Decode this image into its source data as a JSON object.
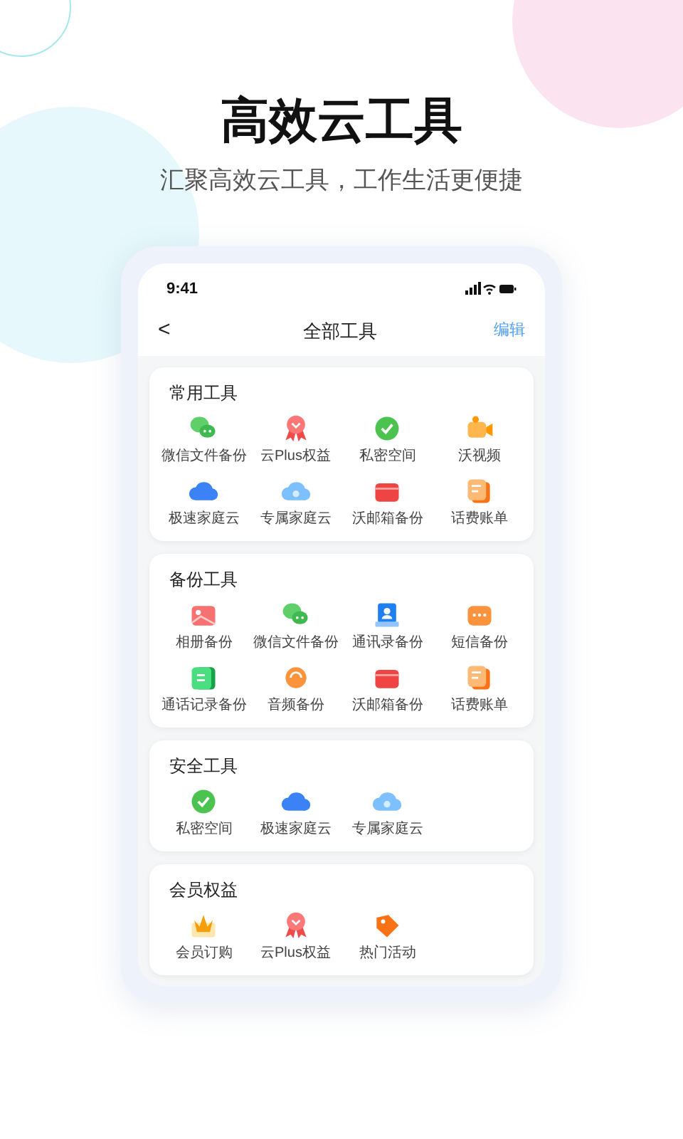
{
  "headline": "高效云工具",
  "subtitle": "汇聚高效云工具，工作生活更便捷",
  "status_bar": {
    "time": "9:41"
  },
  "nav": {
    "back": "<",
    "title": "全部工具",
    "action": "编辑"
  },
  "sections": [
    {
      "title": "常用工具",
      "tools": [
        {
          "label": "微信文件备份",
          "kind": "chat"
        },
        {
          "label": "云Plus权益",
          "kind": "ribbon"
        },
        {
          "label": "私密空间",
          "kind": "shield"
        },
        {
          "label": "沃视频",
          "kind": "camera"
        },
        {
          "label": "极速家庭云",
          "kind": "cloud"
        },
        {
          "label": "专属家庭云",
          "kind": "cloud-light"
        },
        {
          "label": "沃邮箱备份",
          "kind": "mail"
        },
        {
          "label": "话费账单",
          "kind": "bill"
        }
      ]
    },
    {
      "title": "备份工具",
      "tools": [
        {
          "label": "相册备份",
          "kind": "photo"
        },
        {
          "label": "微信文件备份",
          "kind": "chat"
        },
        {
          "label": "通讯录备份",
          "kind": "contact"
        },
        {
          "label": "短信备份",
          "kind": "sms"
        },
        {
          "label": "通话记录备份",
          "kind": "note"
        },
        {
          "label": "音频备份",
          "kind": "audio"
        },
        {
          "label": "沃邮箱备份",
          "kind": "mail"
        },
        {
          "label": "话费账单",
          "kind": "bill"
        }
      ]
    },
    {
      "title": "安全工具",
      "tools": [
        {
          "label": "私密空间",
          "kind": "shield"
        },
        {
          "label": "极速家庭云",
          "kind": "cloud"
        },
        {
          "label": "专属家庭云",
          "kind": "cloud-light"
        }
      ]
    },
    {
      "title": "会员权益",
      "tools": [
        {
          "label": "会员订购",
          "kind": "crown"
        },
        {
          "label": "云Plus权益",
          "kind": "ribbon"
        },
        {
          "label": "热门活动",
          "kind": "tag"
        }
      ]
    }
  ]
}
